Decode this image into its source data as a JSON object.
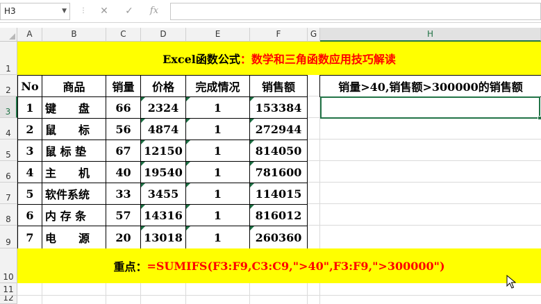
{
  "formula_bar": {
    "name_box": "H3",
    "cancel_icon": "✕",
    "enter_icon": "✓",
    "function_icon": "fx",
    "formula_value": ""
  },
  "columns": [
    "A",
    "B",
    "C",
    "D",
    "E",
    "F",
    "G",
    "H"
  ],
  "rows": [
    "1",
    "2",
    "3",
    "4",
    "5",
    "6",
    "7",
    "8",
    "9",
    "10",
    "11",
    "12"
  ],
  "selected_cell": "H3",
  "title": {
    "part1": "Excel函数公式",
    "sep": "：",
    "part2": "数学和三角函数应用技巧解读"
  },
  "table": {
    "headers": [
      "No",
      "商品",
      "销量",
      "价格",
      "完成情况",
      "销售额"
    ],
    "rows": [
      [
        "1",
        "键　　盘",
        "66",
        "2324",
        "1",
        "153384"
      ],
      [
        "2",
        "鼠　　标",
        "56",
        "4874",
        "1",
        "272944"
      ],
      [
        "3",
        "鼠 标 垫",
        "67",
        "12150",
        "1",
        "814050"
      ],
      [
        "4",
        "主　　机",
        "40",
        "19540",
        "1",
        "781600"
      ],
      [
        "5",
        "软件系统",
        "33",
        "3455",
        "1",
        "114015"
      ],
      [
        "6",
        "内 存 条",
        "57",
        "14316",
        "1",
        "816012"
      ],
      [
        "7",
        "电　　源",
        "20",
        "13018",
        "1",
        "260360"
      ]
    ]
  },
  "result": {
    "header": "销量>40,销售额>300000的销售额",
    "value": ""
  },
  "note": {
    "label": "重点：",
    "formula": "=SUMIFS(F3:F9,C3:C9,\">40\",F3:F9,\">300000\")"
  },
  "colors": {
    "band": "#ffff00",
    "accent_red": "#ff0000",
    "selection_green": "#217346"
  }
}
